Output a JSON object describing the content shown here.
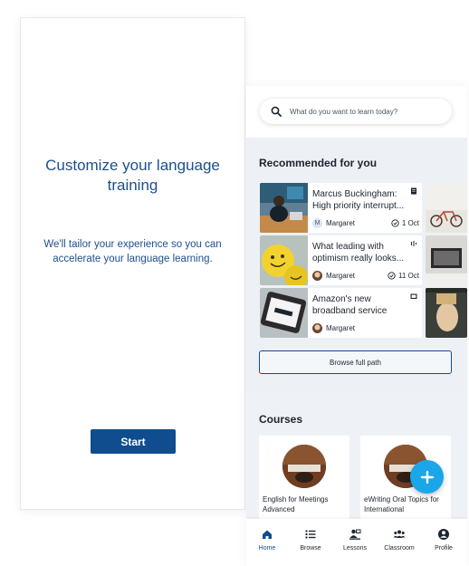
{
  "onboarding": {
    "title": "Customize your language training",
    "subtitle": "We'll tailor your experience so you can accelerate your language learning.",
    "start_label": "Start"
  },
  "search": {
    "placeholder": "What do you want to learn today?",
    "icon": "search-icon"
  },
  "recommended": {
    "title": "Recommended for you",
    "items": [
      {
        "text": "Marcus Buckingham: High priority interrupt...",
        "author": "Margaret",
        "avatar_letter": "M",
        "date": "1 Oct",
        "type_icon": "document-icon"
      },
      {
        "text": "What leading with optimism really looks...",
        "author": "Margaret",
        "date": "11 Oct",
        "type_icon": "audio-icon"
      },
      {
        "text": "Amazon's new broadband service",
        "author": "Margaret",
        "type_icon": "video-icon"
      }
    ],
    "browse_label": "Browse full path"
  },
  "courses": {
    "title": "Courses",
    "items": [
      {
        "title": "English for Meetings Advanced"
      },
      {
        "title": "eWriting Oral Topics for International"
      }
    ]
  },
  "fab": {
    "icon": "plus-icon"
  },
  "nav": {
    "items": [
      {
        "label": "Home",
        "icon": "home-icon",
        "active": true
      },
      {
        "label": "Browse",
        "icon": "list-icon"
      },
      {
        "label": "Lessons",
        "icon": "lessons-icon"
      },
      {
        "label": "Classroom",
        "icon": "classroom-icon"
      },
      {
        "label": "Profile",
        "icon": "profile-icon"
      }
    ]
  },
  "colors": {
    "primary": "#0f4d8f",
    "accent": "#1aa6e8",
    "heading_text": "#1d4f8e"
  }
}
